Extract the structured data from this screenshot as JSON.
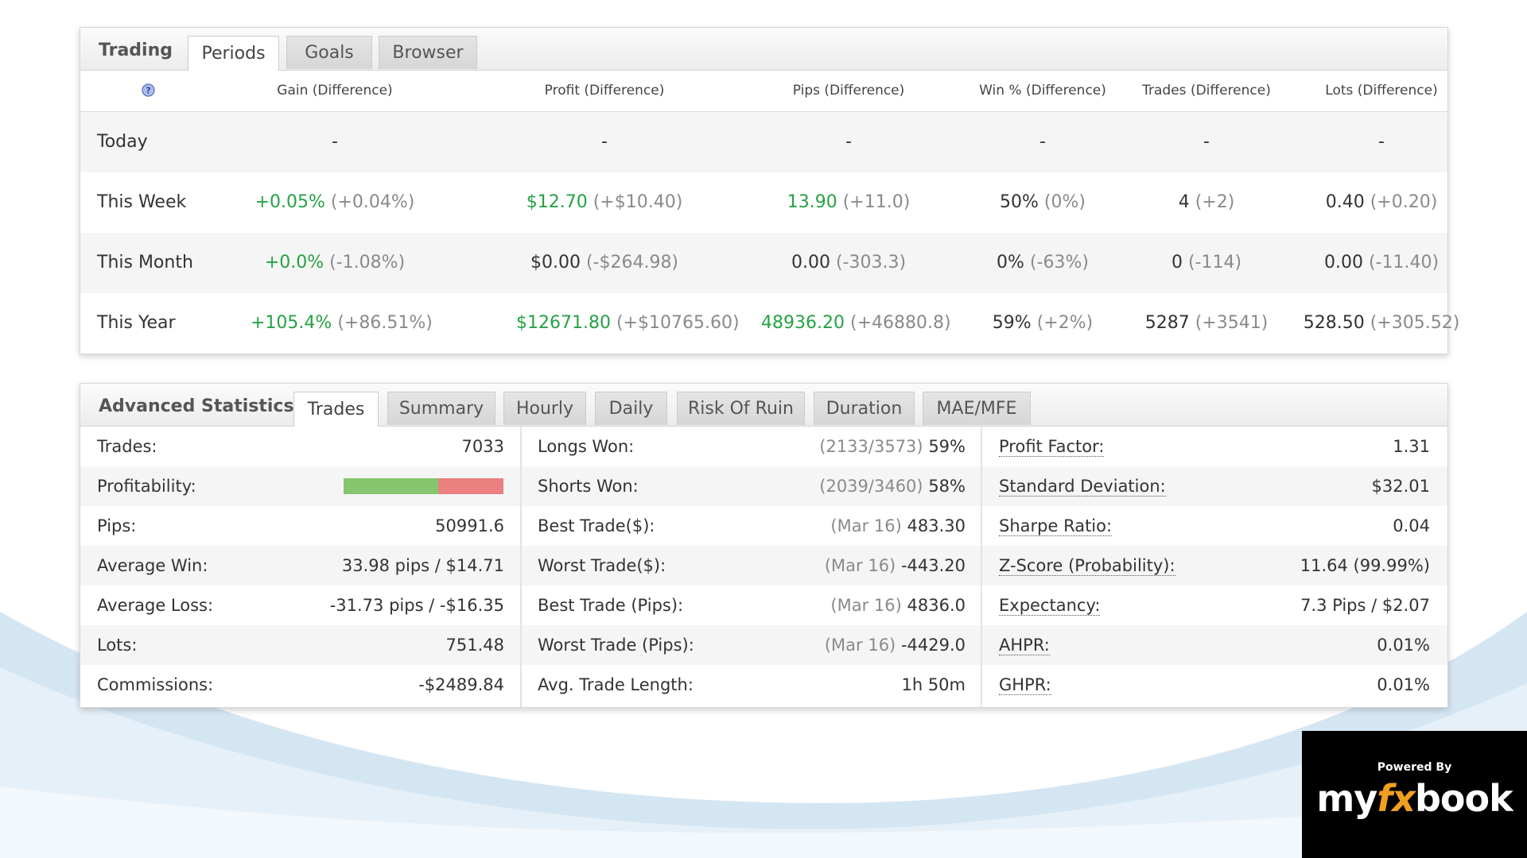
{
  "trading": {
    "title": "Trading",
    "tabs": [
      "Periods",
      "Goals",
      "Browser"
    ],
    "active_tab": "Periods",
    "columns": [
      "Gain (Difference)",
      "Profit (Difference)",
      "Pips (Difference)",
      "Win % (Difference)",
      "Trades (Difference)",
      "Lots (Difference)"
    ],
    "rows": [
      {
        "label": "Today",
        "cells": [
          {
            "value": "-",
            "diff": ""
          },
          {
            "value": "-",
            "diff": ""
          },
          {
            "value": "-",
            "diff": ""
          },
          {
            "value": "-",
            "diff": ""
          },
          {
            "value": "-",
            "diff": ""
          },
          {
            "value": "-",
            "diff": ""
          }
        ]
      },
      {
        "label": "This Week",
        "cells": [
          {
            "value": "+0.05%",
            "diff": "(+0.04%)"
          },
          {
            "value": "$12.70",
            "diff": "(+$10.40)"
          },
          {
            "value": "13.90",
            "diff": "(+11.0)"
          },
          {
            "value": "50%",
            "diff": "(0%)"
          },
          {
            "value": "4",
            "diff": "(+2)"
          },
          {
            "value": "0.40",
            "diff": "(+0.20)"
          }
        ]
      },
      {
        "label": "This Month",
        "cells": [
          {
            "value": "+0.0%",
            "diff": "(-1.08%)"
          },
          {
            "value": "$0.00",
            "diff": "(-$264.98)"
          },
          {
            "value": "0.00",
            "diff": "(-303.3)"
          },
          {
            "value": "0%",
            "diff": "(-63%)"
          },
          {
            "value": "0",
            "diff": "(-114)"
          },
          {
            "value": "0.00",
            "diff": "(-11.40)"
          }
        ]
      },
      {
        "label": "This Year",
        "cells": [
          {
            "value": "+105.4%",
            "diff": "(+86.51%)"
          },
          {
            "value": "$12671.80",
            "diff": "(+$10765.60)"
          },
          {
            "value": "48936.20",
            "diff": "(+46880.8)"
          },
          {
            "value": "59%",
            "diff": "(+2%)"
          },
          {
            "value": "5287",
            "diff": "(+3541)"
          },
          {
            "value": "528.50",
            "diff": "(+305.52)"
          }
        ]
      }
    ]
  },
  "advanced": {
    "title": "Advanced Statistics",
    "tabs": [
      "Trades",
      "Summary",
      "Hourly",
      "Daily",
      "Risk Of Ruin",
      "Duration",
      "MAE/MFE"
    ],
    "active_tab": "Trades",
    "col1": [
      {
        "label": "Trades:",
        "value": "7033"
      },
      {
        "label": "Profitability:",
        "value": ""
      },
      {
        "label": "Pips:",
        "value": "50991.6"
      },
      {
        "label": "Average Win:",
        "value": "33.98 pips / $14.71"
      },
      {
        "label": "Average Loss:",
        "value": "-31.73 pips / -$16.35"
      },
      {
        "label": "Lots:",
        "value": "751.48"
      },
      {
        "label": "Commissions:",
        "value": "-$2489.84"
      }
    ],
    "profitability_win_fraction": 0.59,
    "col2": [
      {
        "label": "Longs Won:",
        "meta": "(2133/3573)",
        "value": "59%"
      },
      {
        "label": "Shorts Won:",
        "meta": "(2039/3460)",
        "value": "58%"
      },
      {
        "label": "Best Trade($):",
        "meta": "(Mar 16)",
        "value": "483.30"
      },
      {
        "label": "Worst Trade($):",
        "meta": "(Mar 16)",
        "value": "-443.20"
      },
      {
        "label": "Best Trade (Pips):",
        "meta": "(Mar 16)",
        "value": "4836.0"
      },
      {
        "label": "Worst Trade (Pips):",
        "meta": "(Mar 16)",
        "value": "-4429.0"
      },
      {
        "label": "Avg. Trade Length:",
        "meta": "",
        "value": "1h 50m"
      }
    ],
    "col3": [
      {
        "label": "Profit Factor:",
        "value": "1.31"
      },
      {
        "label": "Standard Deviation:",
        "value": "$32.01"
      },
      {
        "label": "Sharpe Ratio:",
        "value": "0.04"
      },
      {
        "label": "Z-Score (Probability):",
        "value": "11.64 (99.99%)"
      },
      {
        "label": "Expectancy:",
        "value": "7.3 Pips / $2.07"
      },
      {
        "label": "AHPR:",
        "value": "0.01%"
      },
      {
        "label": "GHPR:",
        "value": "0.01%"
      }
    ]
  },
  "badge": {
    "powered_by": "Powered By",
    "logo_my": "my",
    "logo_fx": "fx",
    "logo_book": "book"
  },
  "colors": {
    "positive": "#25a244",
    "difference": "#8a8a8a",
    "profit_bar_win": "#86c66f",
    "profit_bar_loss": "#ea8080",
    "logo_accent": "#f0a020"
  },
  "icons": {
    "help": "question-circle-icon"
  }
}
